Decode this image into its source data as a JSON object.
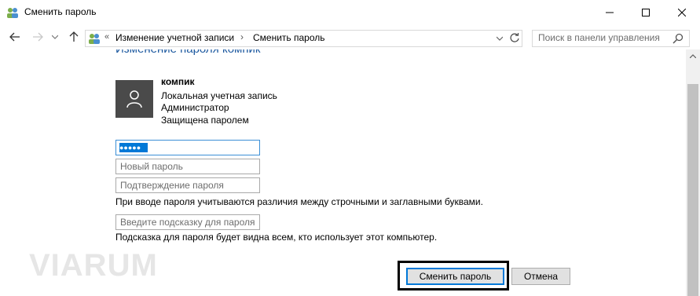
{
  "window": {
    "title": "Сменить пароль",
    "icon": "control-panel-users-icon"
  },
  "nav": {
    "back_icon": "arrow-left-icon",
    "forward_icon": "arrow-right-icon",
    "recent_icon": "chevron-down-icon",
    "up_icon": "arrow-up-icon"
  },
  "address": {
    "overflow": "«",
    "crumbs": [
      "Изменение учетной записи",
      "Сменить пароль"
    ],
    "separator": "›"
  },
  "search": {
    "placeholder": "Поиск в панели управления"
  },
  "page": {
    "title": "Изменение пароля компик"
  },
  "user": {
    "name": "компик",
    "account_type": "Локальная учетная запись",
    "role": "Администратор",
    "protection": "Защищена паролем"
  },
  "form": {
    "current_password_mask": "●●●●●",
    "new_password_placeholder": "Новый пароль",
    "confirm_placeholder": "Подтверждение пароля",
    "case_note": "При вводе пароля учитываются различия между строчными и заглавными буквами.",
    "hint_placeholder": "Введите подсказку для пароля",
    "hint_note": "Подсказка для пароля будет видна всем, кто использует этот компьютер."
  },
  "buttons": {
    "change": "Сменить пароль",
    "cancel": "Отмена"
  },
  "watermark": "VIARUM",
  "colors": {
    "accent": "#0078d7",
    "title_blue": "#1e5aa0"
  }
}
